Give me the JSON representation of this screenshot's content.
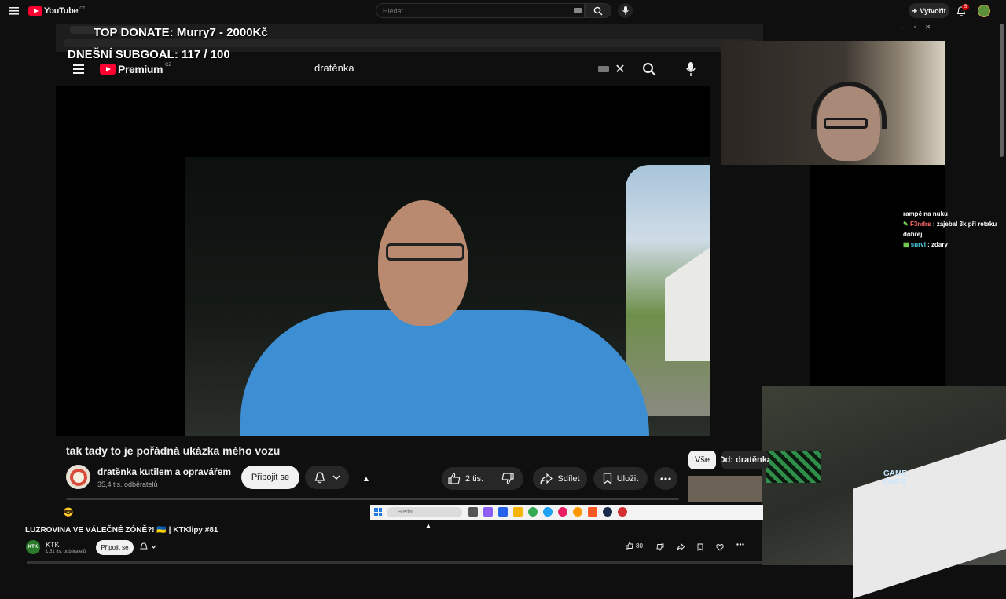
{
  "outer": {
    "logo_text": "YouTube",
    "logo_region": "CZ",
    "search_placeholder": "Hledat",
    "create_label": "Vytvořit",
    "notification_count": "5"
  },
  "overlay": {
    "donate_text": "TOP DONATE: Murry7 - 2000Kč",
    "subgoal_text": "DNEŠNÍ SUBGOAL: 117 / 100"
  },
  "inner": {
    "logo_text": "Premium",
    "logo_region": "CZ",
    "search_value": "dratěnka"
  },
  "video": {
    "title": "tak tady to je pořádná ukázka mého vozu",
    "channel_name": "dratěnka kutilem a opravářem",
    "channel_subs": "35,4 tis. odběratelů",
    "subscribe_label": "Připojit se",
    "likes": "2 tis.",
    "share_label": "Sdílet",
    "save_label": "Uložit"
  },
  "chips": {
    "all": "Vše",
    "from": "Od: dratěnka"
  },
  "chat": {
    "line1": "rampě na nuku",
    "user2": "F3ndrs",
    "msg2": "zajebal 3k při retaku dobrej",
    "user3": "survi",
    "msg3": "zdary",
    "user2_color": "#ff6b6b",
    "user3_color": "#4fd6e8"
  },
  "cam2": {
    "game_over_line1": "GAME",
    "game_over_line2": "OVER"
  },
  "taskbar": {
    "search_placeholder": "Hledat"
  },
  "bottom": {
    "title": "LUZROVINA VE VÁLEČNÉ ZÓNĚ?! 🇺🇦 | KTKlipy #81",
    "channel_name": "KTK",
    "channel_subs": "1,51 tis. odběratelů",
    "subscribe_label": "Připojit se",
    "likes": "80",
    "avatar_text": "KTK"
  },
  "colors": {
    "yt_red": "#ff0033",
    "background": "#0f0f0f",
    "button_bg": "#272727"
  }
}
